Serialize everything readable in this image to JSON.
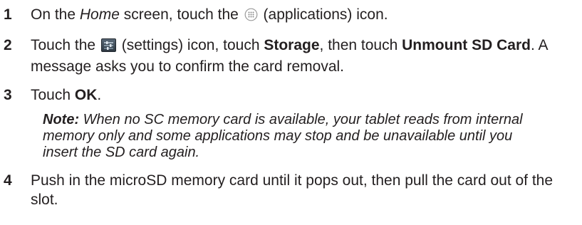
{
  "steps": [
    {
      "number": "1",
      "t1": "On the ",
      "t2": "Home",
      "t3": " screen, touch the ",
      "icon": "applications-icon",
      "t4": " (applications) icon."
    },
    {
      "number": "2",
      "t1": "Touch the ",
      "icon": "settings-icon",
      "t2": " (settings) icon, touch ",
      "t3": "Storage",
      "t4": ", then touch ",
      "t5": "Unmount SD Card",
      "t6": ". A message asks you to confirm the card removal."
    },
    {
      "number": "3",
      "t1": "Touch ",
      "t2": "OK",
      "t3": "."
    },
    {
      "number": "4",
      "t1": "Push in the microSD memory card until it pops out, then pull the card out of the slot."
    }
  ],
  "note": {
    "label": "Note:",
    "text": " When no SC memory card is available, your tablet reads from internal memory only and some applications may stop and be unavailable until you insert the SD card again."
  }
}
